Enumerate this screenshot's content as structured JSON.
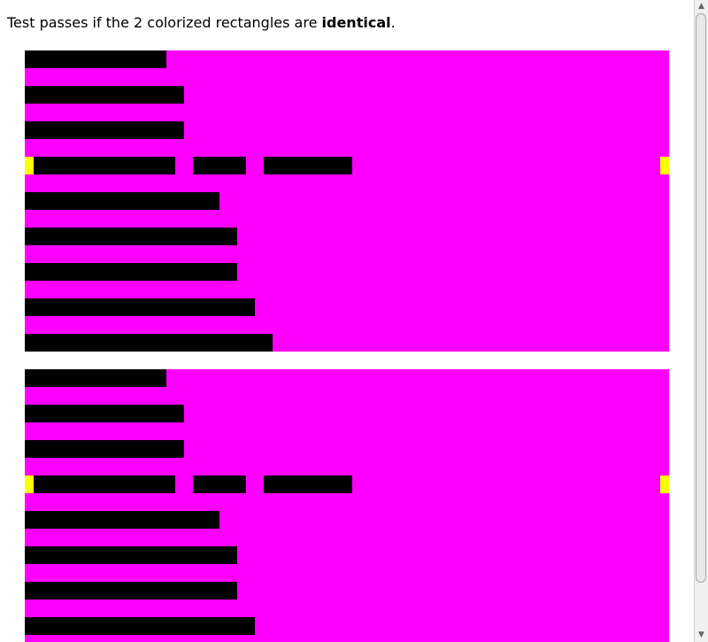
{
  "instructions": {
    "prefix": "Test passes if the 2 colorized rectangles are ",
    "emphasis": "identical",
    "suffix": "."
  },
  "colors": {
    "rectangle_background": "#ff00ff",
    "line_fill": "#000000",
    "marker": "#ffff00",
    "page_background": "#ffffff"
  },
  "scrollbar": {
    "up_icon": "arrow-up-icon",
    "down_icon": "arrow-down-icon"
  }
}
